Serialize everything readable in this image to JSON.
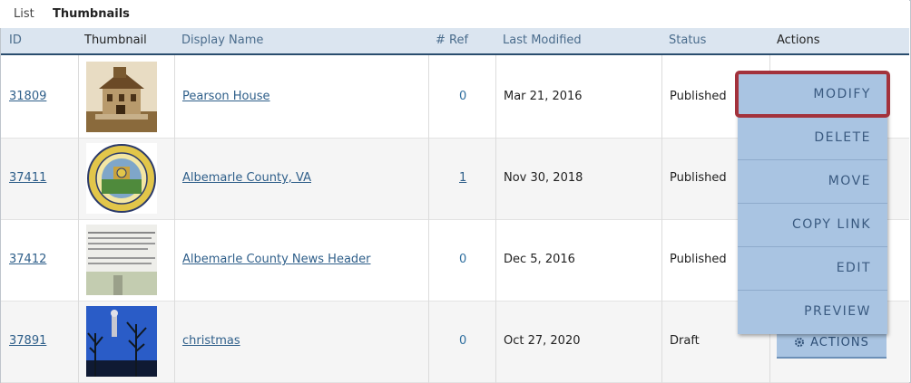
{
  "view_tabs": {
    "list": "List",
    "thumbnails": "Thumbnails"
  },
  "columns": {
    "id": "ID",
    "thumbnail": "Thumbnail",
    "display_name": "Display Name",
    "ref": "# Ref",
    "last_modified": "Last Modified",
    "status": "Status",
    "actions": "Actions"
  },
  "rows": [
    {
      "id": "31809",
      "name": "Pearson House",
      "ref": "0",
      "modified": "Mar 21, 2016",
      "status": "Published"
    },
    {
      "id": "37411",
      "name": "Albemarle County, VA",
      "ref": "1",
      "modified": "Nov 30, 2018",
      "status": "Published"
    },
    {
      "id": "37412",
      "name": "Albemarle County News Header",
      "ref": "0",
      "modified": "Dec 5, 2016",
      "status": "Published"
    },
    {
      "id": "37891",
      "name": "christmas",
      "ref": "0",
      "modified": "Oct 27, 2020",
      "status": "Draft"
    }
  ],
  "actions_button": "ACTIONS",
  "menu": {
    "modify": "MODIFY",
    "delete": "DELETE",
    "move": "MOVE",
    "copy_link": "COPY LINK",
    "edit": "EDIT",
    "preview": "PREVIEW"
  },
  "colors": {
    "header_bg": "#dbe5f0",
    "menu_bg": "#a9c4e2",
    "highlight": "#a3323c",
    "link": "#2f5f8a"
  }
}
